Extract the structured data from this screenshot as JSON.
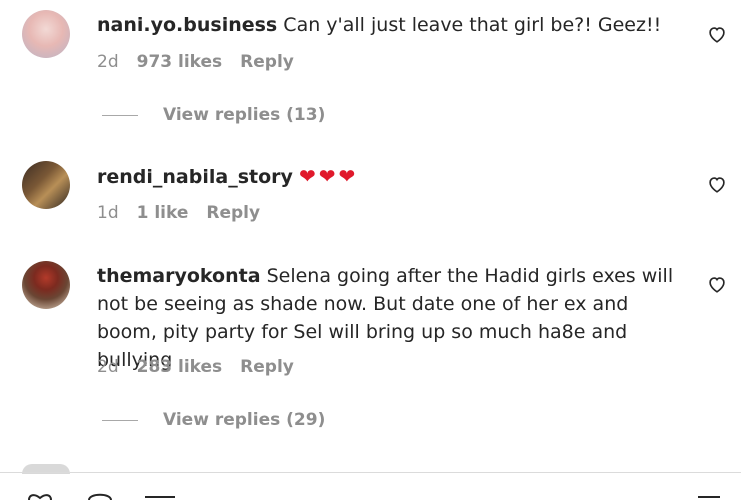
{
  "comments": [
    {
      "username": "nani.yo.business",
      "text": "Can y'all just leave that girl be?! Geez!!",
      "age": "2d",
      "likes": "973 likes",
      "reply_label": "Reply",
      "view_replies": "View replies (13)"
    },
    {
      "username": "rendi_nabila_story",
      "text": "❤❤❤",
      "age": "1d",
      "likes": "1 like",
      "reply_label": "Reply"
    },
    {
      "username": "themaryokonta",
      "text": "Selena going after the Hadid girls exes will not be seeing as shade now. But date one of her ex and boom, pity party for Sel will bring up so much ha8e and bullying",
      "age": "2d",
      "likes": "283 likes",
      "reply_label": "Reply",
      "view_replies": "View replies (29)"
    }
  ],
  "colors": {
    "text": "#262626",
    "muted": "#8e8e8e",
    "heart": "#e0192b",
    "divider": "#dbdbdb"
  },
  "icons": [
    "heart-outline-icon",
    "like-icon",
    "comment-icon",
    "share-icon",
    "save-icon"
  ]
}
